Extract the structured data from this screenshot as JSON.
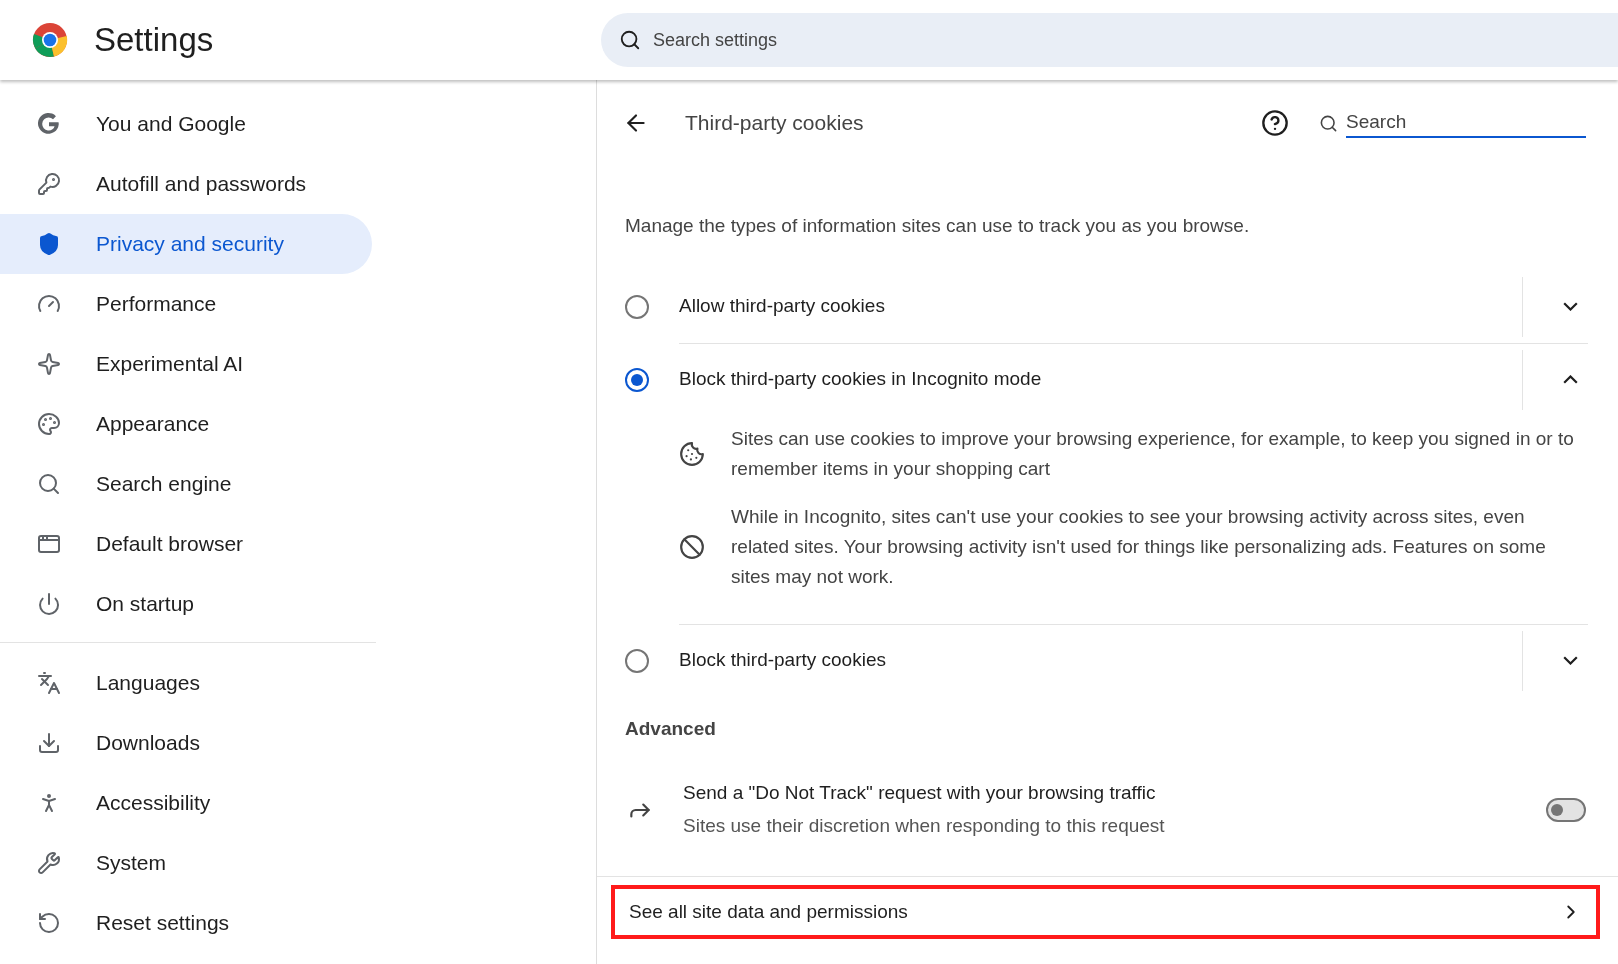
{
  "header": {
    "title": "Settings",
    "search": {
      "placeholder": "Search settings"
    }
  },
  "sidebar": {
    "groups": [
      {
        "items": [
          {
            "label": "You and Google",
            "selected": false
          },
          {
            "label": "Autofill and passwords",
            "selected": false
          },
          {
            "label": "Privacy and security",
            "selected": true
          },
          {
            "label": "Performance",
            "selected": false
          },
          {
            "label": "Experimental AI",
            "selected": false
          },
          {
            "label": "Appearance",
            "selected": false
          },
          {
            "label": "Search engine",
            "selected": false
          },
          {
            "label": "Default browser",
            "selected": false
          },
          {
            "label": "On startup",
            "selected": false
          }
        ]
      },
      {
        "items": [
          {
            "label": "Languages",
            "selected": false
          },
          {
            "label": "Downloads",
            "selected": false
          },
          {
            "label": "Accessibility",
            "selected": false
          },
          {
            "label": "System",
            "selected": false
          },
          {
            "label": "Reset settings",
            "selected": false
          }
        ]
      }
    ]
  },
  "page": {
    "title": "Third-party cookies",
    "search": {
      "placeholder": "Search"
    },
    "description": "Manage the types of information sites can use to track you as you browse.",
    "options": [
      {
        "label": "Allow third-party cookies",
        "selected": false,
        "expanded": false
      },
      {
        "label": "Block third-party cookies in Incognito mode",
        "selected": true,
        "expanded": true,
        "details": [
          {
            "kind": "cookie",
            "text": "Sites can use cookies to improve your browsing experience, for example, to keep you signed in or to remember items in your shopping cart"
          },
          {
            "kind": "blocked",
            "text": "While in Incognito, sites can't use your cookies to see your browsing activity across sites, even related sites. Your browsing activity isn't used for things like personalizing ads. Features on some sites may not work."
          }
        ]
      },
      {
        "label": "Block third-party cookies",
        "selected": false,
        "expanded": false
      }
    ],
    "advanced": {
      "heading": "Advanced",
      "toggle": {
        "label": "Send a \"Do Not Track\" request with your browsing traffic",
        "sublabel": "Sites use their discretion when responding to this request",
        "on": false
      }
    },
    "link": {
      "label": "See all site data and permissions",
      "highlighted": true
    }
  }
}
